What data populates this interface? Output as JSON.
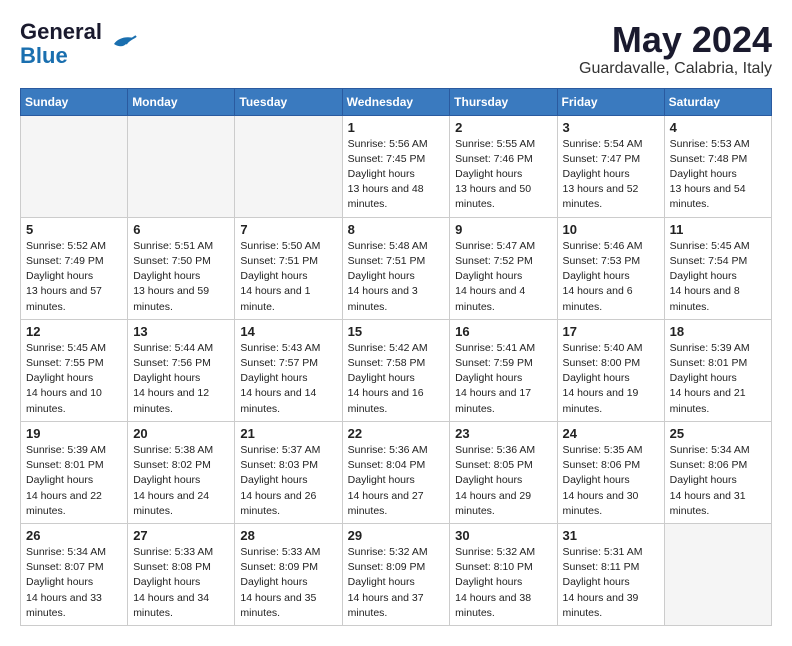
{
  "header": {
    "logo_general": "General",
    "logo_blue": "Blue",
    "month_title": "May 2024",
    "location": "Guardavalle, Calabria, Italy"
  },
  "weekdays": [
    "Sunday",
    "Monday",
    "Tuesday",
    "Wednesday",
    "Thursday",
    "Friday",
    "Saturday"
  ],
  "weeks": [
    [
      {
        "day": "",
        "empty": true
      },
      {
        "day": "",
        "empty": true
      },
      {
        "day": "",
        "empty": true
      },
      {
        "day": "1",
        "sunrise": "5:56 AM",
        "sunset": "7:45 PM",
        "daylight": "13 hours and 48 minutes."
      },
      {
        "day": "2",
        "sunrise": "5:55 AM",
        "sunset": "7:46 PM",
        "daylight": "13 hours and 50 minutes."
      },
      {
        "day": "3",
        "sunrise": "5:54 AM",
        "sunset": "7:47 PM",
        "daylight": "13 hours and 52 minutes."
      },
      {
        "day": "4",
        "sunrise": "5:53 AM",
        "sunset": "7:48 PM",
        "daylight": "13 hours and 54 minutes."
      }
    ],
    [
      {
        "day": "5",
        "sunrise": "5:52 AM",
        "sunset": "7:49 PM",
        "daylight": "13 hours and 57 minutes."
      },
      {
        "day": "6",
        "sunrise": "5:51 AM",
        "sunset": "7:50 PM",
        "daylight": "13 hours and 59 minutes."
      },
      {
        "day": "7",
        "sunrise": "5:50 AM",
        "sunset": "7:51 PM",
        "daylight": "14 hours and 1 minute."
      },
      {
        "day": "8",
        "sunrise": "5:48 AM",
        "sunset": "7:51 PM",
        "daylight": "14 hours and 3 minutes."
      },
      {
        "day": "9",
        "sunrise": "5:47 AM",
        "sunset": "7:52 PM",
        "daylight": "14 hours and 4 minutes."
      },
      {
        "day": "10",
        "sunrise": "5:46 AM",
        "sunset": "7:53 PM",
        "daylight": "14 hours and 6 minutes."
      },
      {
        "day": "11",
        "sunrise": "5:45 AM",
        "sunset": "7:54 PM",
        "daylight": "14 hours and 8 minutes."
      }
    ],
    [
      {
        "day": "12",
        "sunrise": "5:45 AM",
        "sunset": "7:55 PM",
        "daylight": "14 hours and 10 minutes."
      },
      {
        "day": "13",
        "sunrise": "5:44 AM",
        "sunset": "7:56 PM",
        "daylight": "14 hours and 12 minutes."
      },
      {
        "day": "14",
        "sunrise": "5:43 AM",
        "sunset": "7:57 PM",
        "daylight": "14 hours and 14 minutes."
      },
      {
        "day": "15",
        "sunrise": "5:42 AM",
        "sunset": "7:58 PM",
        "daylight": "14 hours and 16 minutes."
      },
      {
        "day": "16",
        "sunrise": "5:41 AM",
        "sunset": "7:59 PM",
        "daylight": "14 hours and 17 minutes."
      },
      {
        "day": "17",
        "sunrise": "5:40 AM",
        "sunset": "8:00 PM",
        "daylight": "14 hours and 19 minutes."
      },
      {
        "day": "18",
        "sunrise": "5:39 AM",
        "sunset": "8:01 PM",
        "daylight": "14 hours and 21 minutes."
      }
    ],
    [
      {
        "day": "19",
        "sunrise": "5:39 AM",
        "sunset": "8:01 PM",
        "daylight": "14 hours and 22 minutes."
      },
      {
        "day": "20",
        "sunrise": "5:38 AM",
        "sunset": "8:02 PM",
        "daylight": "14 hours and 24 minutes."
      },
      {
        "day": "21",
        "sunrise": "5:37 AM",
        "sunset": "8:03 PM",
        "daylight": "14 hours and 26 minutes."
      },
      {
        "day": "22",
        "sunrise": "5:36 AM",
        "sunset": "8:04 PM",
        "daylight": "14 hours and 27 minutes."
      },
      {
        "day": "23",
        "sunrise": "5:36 AM",
        "sunset": "8:05 PM",
        "daylight": "14 hours and 29 minutes."
      },
      {
        "day": "24",
        "sunrise": "5:35 AM",
        "sunset": "8:06 PM",
        "daylight": "14 hours and 30 minutes."
      },
      {
        "day": "25",
        "sunrise": "5:34 AM",
        "sunset": "8:06 PM",
        "daylight": "14 hours and 31 minutes."
      }
    ],
    [
      {
        "day": "26",
        "sunrise": "5:34 AM",
        "sunset": "8:07 PM",
        "daylight": "14 hours and 33 minutes."
      },
      {
        "day": "27",
        "sunrise": "5:33 AM",
        "sunset": "8:08 PM",
        "daylight": "14 hours and 34 minutes."
      },
      {
        "day": "28",
        "sunrise": "5:33 AM",
        "sunset": "8:09 PM",
        "daylight": "14 hours and 35 minutes."
      },
      {
        "day": "29",
        "sunrise": "5:32 AM",
        "sunset": "8:09 PM",
        "daylight": "14 hours and 37 minutes."
      },
      {
        "day": "30",
        "sunrise": "5:32 AM",
        "sunset": "8:10 PM",
        "daylight": "14 hours and 38 minutes."
      },
      {
        "day": "31",
        "sunrise": "5:31 AM",
        "sunset": "8:11 PM",
        "daylight": "14 hours and 39 minutes."
      },
      {
        "day": "",
        "empty": true
      }
    ]
  ]
}
